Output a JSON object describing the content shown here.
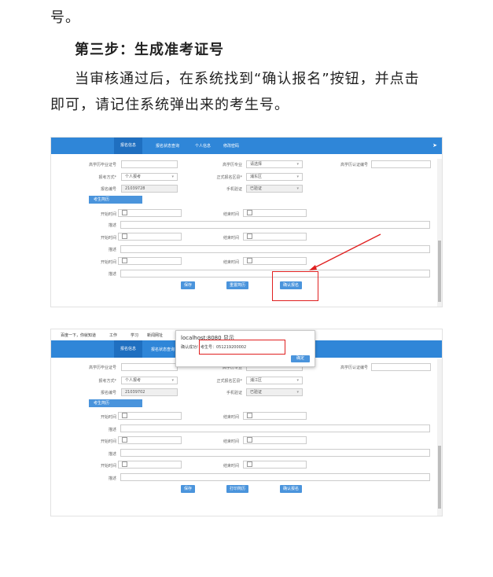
{
  "doc": {
    "line1": "号。",
    "step_heading": "第三步：生成准考证号",
    "para1": "当审核通过后，在系统找到“确认报名”按钮，并点击",
    "para2": "即可，请记住系统弹出来的考生号。"
  },
  "shot1": {
    "tabs": [
      "报名信息",
      "报名状态查询",
      "个人信息",
      "修改密码"
    ],
    "labels": {
      "prev_id": "高学历毕业证号",
      "exam_mode": "报考方式*",
      "reg_no": "报名编号",
      "major": "高学历专业",
      "district": "正式报名区县*",
      "phone_status": "手机验证",
      "cert_no": "高学历认证编号",
      "start_time": "开始时间",
      "end_time": "结束时间",
      "desc": "描述"
    },
    "values": {
      "exam_mode": "个人报考",
      "reg_no": "21039728",
      "major": "请选择",
      "district": "浦东区",
      "phone_status": "已验证"
    },
    "student_tab": "考生简历",
    "buttons": [
      "保存",
      "重置简历",
      "确认报名"
    ]
  },
  "shot2": {
    "bookmarks": [
      "百度一下，你就知道",
      "工作",
      "学习",
      "新闻网址"
    ],
    "tabs": [
      "报名信息",
      "报名状态查询"
    ],
    "dialog": {
      "title": "localhost:8080 显示",
      "message_prefix": "确认成功!",
      "message_value": "考生号：051219200002",
      "ok": "确定"
    },
    "labels": {
      "prev_id": "高学历毕业证号",
      "exam_mode": "报考方式*",
      "reg_no": "报名编号",
      "major": "高学历专业",
      "district": "正式报名区县*",
      "phone_status": "手机验证",
      "cert_no": "高学历认证编号",
      "start_time": "开始时间",
      "end_time": "结束时间",
      "desc": "描述"
    },
    "values": {
      "exam_mode": "个人报考",
      "reg_no": "21039702",
      "district": "浦江区",
      "phone_status": "已验证"
    },
    "student_tab": "考生简历",
    "buttons": [
      "保存",
      "打印简历",
      "确认报名"
    ]
  },
  "colors": {
    "nav": "#2f86d8",
    "button": "#4a94dc",
    "highlight": "#e02020"
  }
}
